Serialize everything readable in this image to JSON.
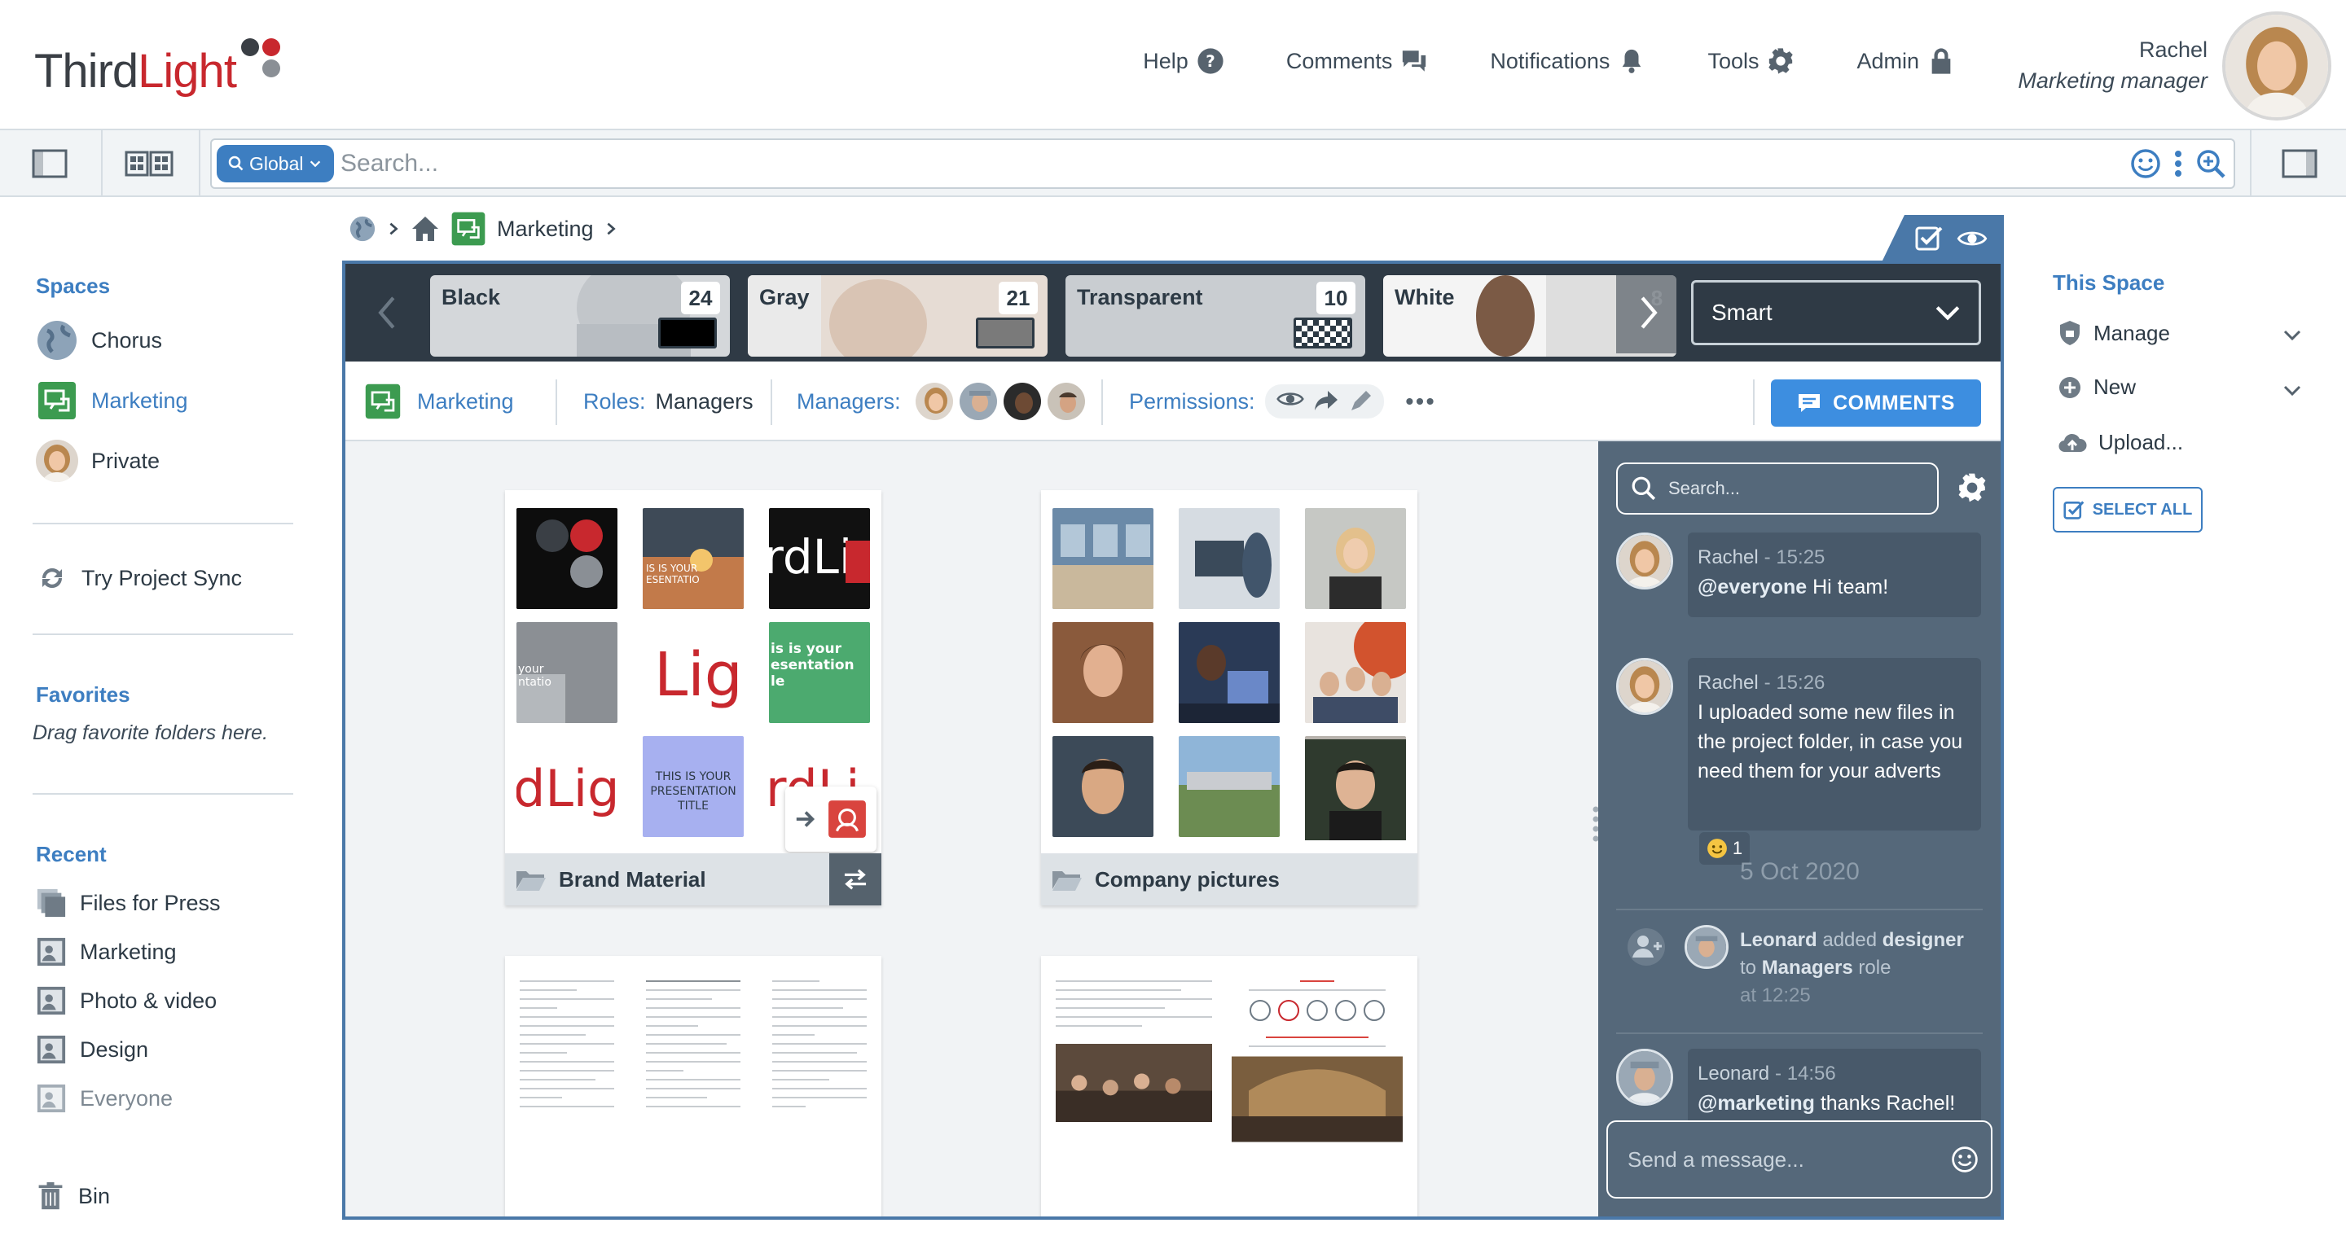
{
  "brand": {
    "logo_part1": "Third",
    "logo_part2": "Light"
  },
  "nav": {
    "help": "Help",
    "comments": "Comments",
    "notifications": "Notifications",
    "tools": "Tools",
    "admin": "Admin"
  },
  "user": {
    "name": "Rachel",
    "role": "Marketing manager"
  },
  "search": {
    "scope": "Global",
    "placeholder": "Search..."
  },
  "sidebar": {
    "spaces_title": "Spaces",
    "spaces": [
      {
        "label": "Chorus"
      },
      {
        "label": "Marketing"
      },
      {
        "label": "Private"
      }
    ],
    "project_sync": "Try Project Sync",
    "favorites_title": "Favorites",
    "favorites_hint": "Drag favorite folders here.",
    "recent_title": "Recent",
    "recent": [
      {
        "label": "Files for Press"
      },
      {
        "label": "Marketing"
      },
      {
        "label": "Photo & video"
      },
      {
        "label": "Design"
      },
      {
        "label": "Everyone"
      }
    ],
    "bin": "Bin"
  },
  "breadcrumb": {
    "current": "Marketing"
  },
  "filters": {
    "cards": [
      {
        "label": "Black",
        "count": "24"
      },
      {
        "label": "Gray",
        "count": "21"
      },
      {
        "label": "Transparent",
        "count": "10"
      },
      {
        "label": "White",
        "count": "8"
      }
    ],
    "mode": "Smart"
  },
  "meta": {
    "space": "Marketing",
    "roles_label": "Roles:",
    "roles_value": "Managers",
    "managers_label": "Managers:",
    "permissions_label": "Permissions:",
    "comments_button": "COMMENTS"
  },
  "folders": [
    {
      "name": "Brand Material"
    },
    {
      "name": "Company pictures"
    }
  ],
  "chat": {
    "search_placeholder": "Search...",
    "messages": [
      {
        "author": "Rachel",
        "time": "- 15:25",
        "mention": "@everyone",
        "text": " Hi team!"
      },
      {
        "author": "Rachel",
        "time": "- 15:26",
        "text": "I uploaded some new files in the project folder, in case you need them for your adverts",
        "reaction_count": "1"
      }
    ],
    "date_separator": "5 Oct 2020",
    "system": {
      "actor": "Leonard",
      "action": " added ",
      "object": "designer",
      "to_text": "to ",
      "role": "Managers",
      "role_suffix": " role",
      "time": "at 12:25"
    },
    "last": {
      "author": "Leonard",
      "time": "- 14:56",
      "mention": "@marketing",
      "text": " thanks Rachel!"
    },
    "input_placeholder": "Send a message..."
  },
  "right": {
    "title": "This Space",
    "manage": "Manage",
    "new": "New",
    "upload": "Upload...",
    "select_all": "SELECT ALL"
  },
  "colors": {
    "accent": "#3d7ec1",
    "brand_red": "#c8282e",
    "panel_dark": "#2f3a45",
    "chat_bg": "#55687a"
  }
}
